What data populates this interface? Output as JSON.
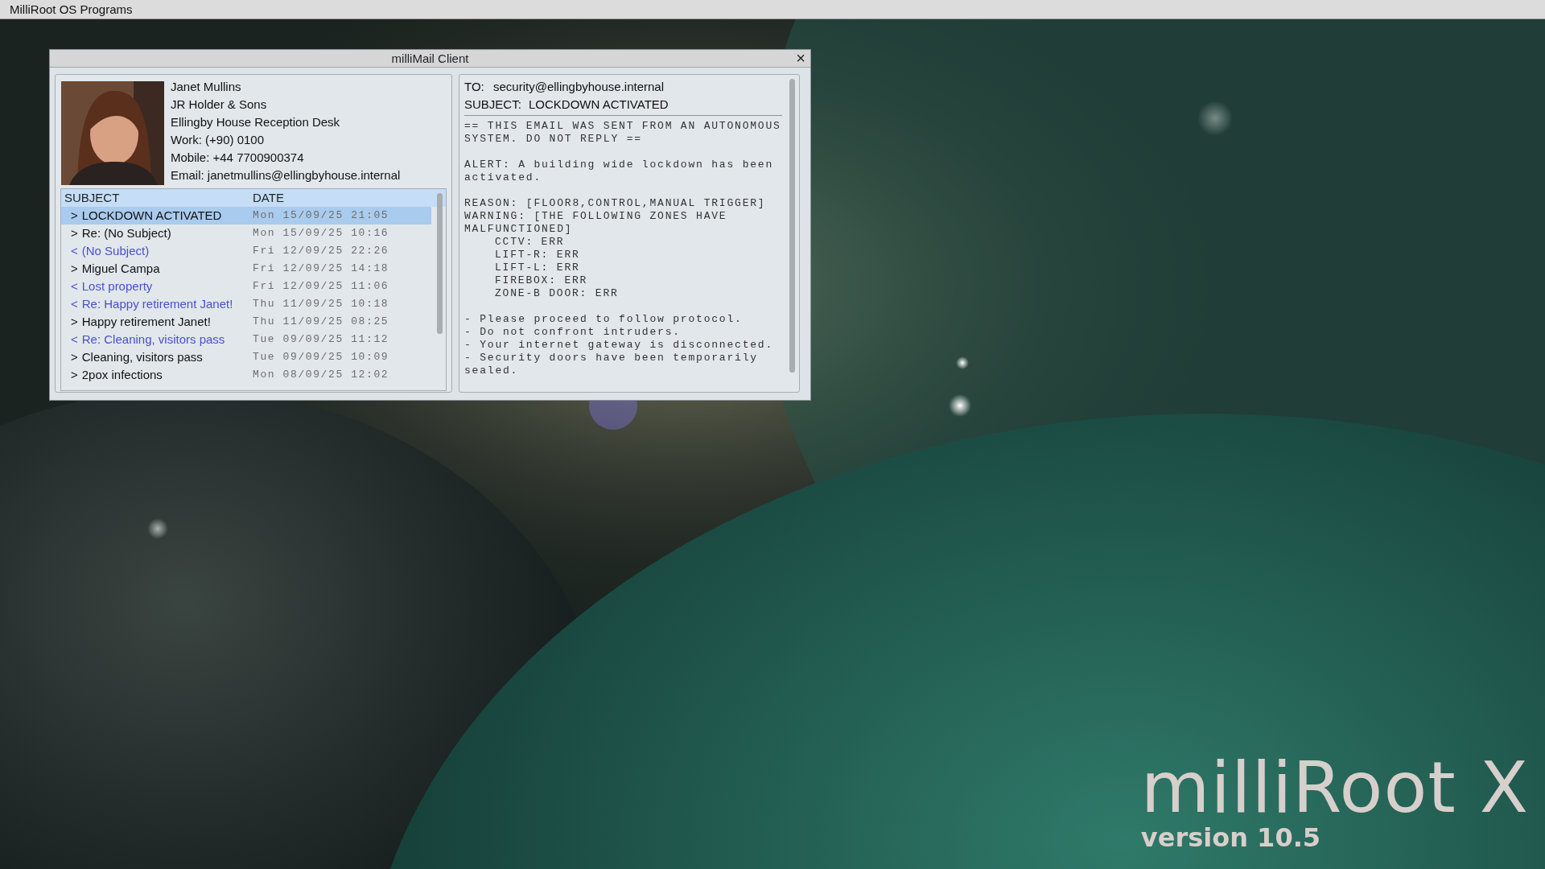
{
  "menu_bar": {
    "title": "MilliRoot OS Programs"
  },
  "window": {
    "title": "milliMail Client",
    "close": "×"
  },
  "contact": {
    "lines": [
      "Janet Mullins",
      "JR Holder & Sons",
      "Ellingby House Reception Desk",
      "Work: (+90) 0100",
      "Mobile: +44 7700900374",
      "Email: janetmullins@ellingbyhouse.internal"
    ]
  },
  "mail_list": {
    "columns": [
      "SUBJECT",
      "DATE"
    ],
    "rows": [
      {
        "marker": ">",
        "subject": "LOCKDOWN ACTIVATED",
        "date": "Mon 15/09/25 21:05",
        "kind": "received",
        "selected": true
      },
      {
        "marker": ">",
        "subject": "Re: (No Subject)",
        "date": "Mon 15/09/25 10:16",
        "kind": "received",
        "selected": false
      },
      {
        "marker": "<",
        "subject": "(No Subject)",
        "date": "Fri 12/09/25 22:26",
        "kind": "sent",
        "selected": false
      },
      {
        "marker": ">",
        "subject": "Miguel Campa",
        "date": "Fri 12/09/25 14:18",
        "kind": "received",
        "selected": false
      },
      {
        "marker": "<",
        "subject": "Lost property",
        "date": "Fri 12/09/25 11:06",
        "kind": "sent",
        "selected": false
      },
      {
        "marker": "<",
        "subject": "Re: Happy retirement Janet!",
        "date": "Thu 11/09/25 10:18",
        "kind": "sent",
        "selected": false
      },
      {
        "marker": ">",
        "subject": "Happy retirement Janet!",
        "date": "Thu 11/09/25 08:25",
        "kind": "received",
        "selected": false
      },
      {
        "marker": "<",
        "subject": "Re: Cleaning, visitors pass",
        "date": "Tue 09/09/25 11:12",
        "kind": "sent",
        "selected": false
      },
      {
        "marker": ">",
        "subject": "Cleaning, visitors pass",
        "date": "Tue 09/09/25 10:09",
        "kind": "received",
        "selected": false
      },
      {
        "marker": ">",
        "subject": "2pox infections",
        "date": "Mon 08/09/25 12:02",
        "kind": "received",
        "selected": false
      }
    ]
  },
  "message": {
    "to_label": "TO:",
    "to": "security@ellingbyhouse.internal",
    "subject_label": "SUBJECT:",
    "subject": "LOCKDOWN ACTIVATED",
    "paragraphs": [
      {
        "lines": [
          {
            "kind": "line",
            "text": "== THIS EMAIL WAS SENT FROM AN AUTONOMOUS SYSTEM. DO NOT REPLY =="
          }
        ]
      },
      {
        "lines": [
          {
            "kind": "line",
            "text": "ALERT: A building wide lockdown has been activated."
          }
        ]
      },
      {
        "lines": [
          {
            "kind": "line",
            "text": "REASON: [FLOOR8,CONTROL,MANUAL TRIGGER]"
          },
          {
            "kind": "line",
            "text": "WARNING: [THE FOLLOWING ZONES HAVE MALFUNCTIONED]"
          },
          {
            "kind": "indent",
            "text": "CCTV: ERR"
          },
          {
            "kind": "indent",
            "text": "LIFT-R: ERR"
          },
          {
            "kind": "indent",
            "text": "LIFT-L: ERR"
          },
          {
            "kind": "indent",
            "text": "FIREBOX: ERR"
          },
          {
            "kind": "indent",
            "text": "ZONE-B DOOR: ERR"
          }
        ]
      },
      {
        "lines": [
          {
            "kind": "line",
            "text": "- Please proceed to follow protocol."
          },
          {
            "kind": "line",
            "text": "- Do not confront intruders."
          },
          {
            "kind": "line",
            "text": "- Your internet gateway is disconnected."
          },
          {
            "kind": "line",
            "text": "- Security doors have been temporarily sealed."
          }
        ]
      }
    ]
  },
  "brand": {
    "name": "milliRoot X",
    "version": "version 10.5"
  }
}
